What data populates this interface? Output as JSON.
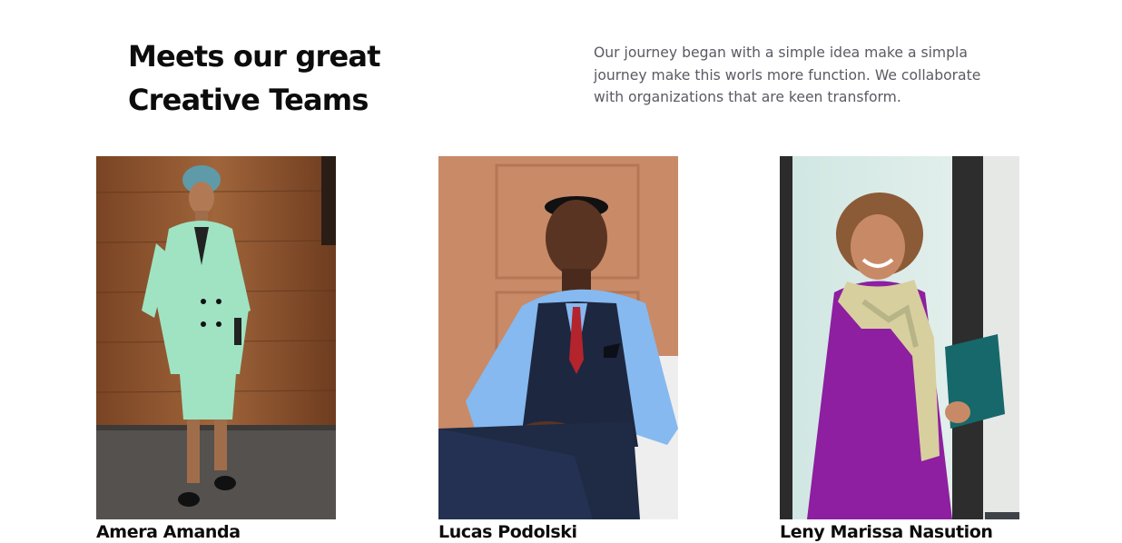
{
  "header": {
    "title": "Meets our great Creative Teams",
    "description": "Our journey began with a simple idea make a simpla journey make this worls more function. We collaborate with organizations that are keen transform."
  },
  "team": [
    {
      "name": "Amera Amanda",
      "photo": "woman-in-mint-suit-photo"
    },
    {
      "name": "Lucas Podolski",
      "photo": "man-in-vest-photo"
    },
    {
      "name": "Leny Marissa Nasution",
      "photo": "woman-in-purple-dress-photo"
    }
  ],
  "colors": {
    "heading": "#0c0c0c",
    "body_text": "#5a5a63",
    "background": "#ffffff"
  }
}
